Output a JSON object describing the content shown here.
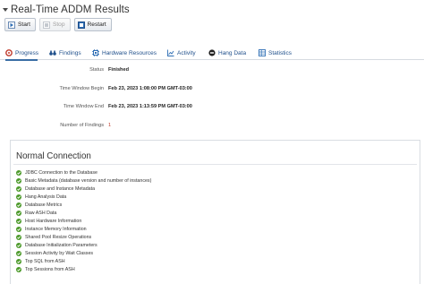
{
  "page": {
    "title": "Real-Time ADDM Results"
  },
  "toolbar": {
    "start_label": "Start",
    "stop_label": "Stop",
    "restart_label": "Restart"
  },
  "tabs": [
    {
      "label": "Progress",
      "icon": "gear-icon"
    },
    {
      "label": "Findings",
      "icon": "binoculars-icon"
    },
    {
      "label": "Hardware Resources",
      "icon": "chip-icon"
    },
    {
      "label": "Activity",
      "icon": "chart-icon"
    },
    {
      "label": "Hang Data",
      "icon": "stop-icon"
    },
    {
      "label": "Statistics",
      "icon": "table-icon"
    }
  ],
  "details": {
    "status_label": "Status",
    "status_value": "Finished",
    "window_begin_label": "Time Window Begin",
    "window_begin_value": "Feb 23, 2023 1:08:00 PM GMT-03:00",
    "window_end_label": "Time Window End",
    "window_end_value": "Feb 23, 2023 1:13:59 PM GMT-03:00",
    "findings_label": "Number of Findings",
    "findings_value": "1"
  },
  "panel": {
    "title": "Normal Connection",
    "items": [
      "JDBC Connection to the Database",
      "Basic Metadata (database version and number of instances)",
      "Database and Instance Metadata",
      "Hang Analysis Data",
      "Database Metrics",
      "Raw ASH Data",
      "Host Hardware Information",
      "Instance Memory Information",
      "Shared Pool Resize Operations",
      "Database Initialization Parameters",
      "Session Activity by Wait Classes",
      "Top SQL from ASH",
      "Top Sessions from ASH"
    ]
  },
  "colors": {
    "accent": "#3a6ea5",
    "link": "#1f4f8b",
    "check": "#4c9a2a",
    "findings_count": "#c0392b"
  }
}
